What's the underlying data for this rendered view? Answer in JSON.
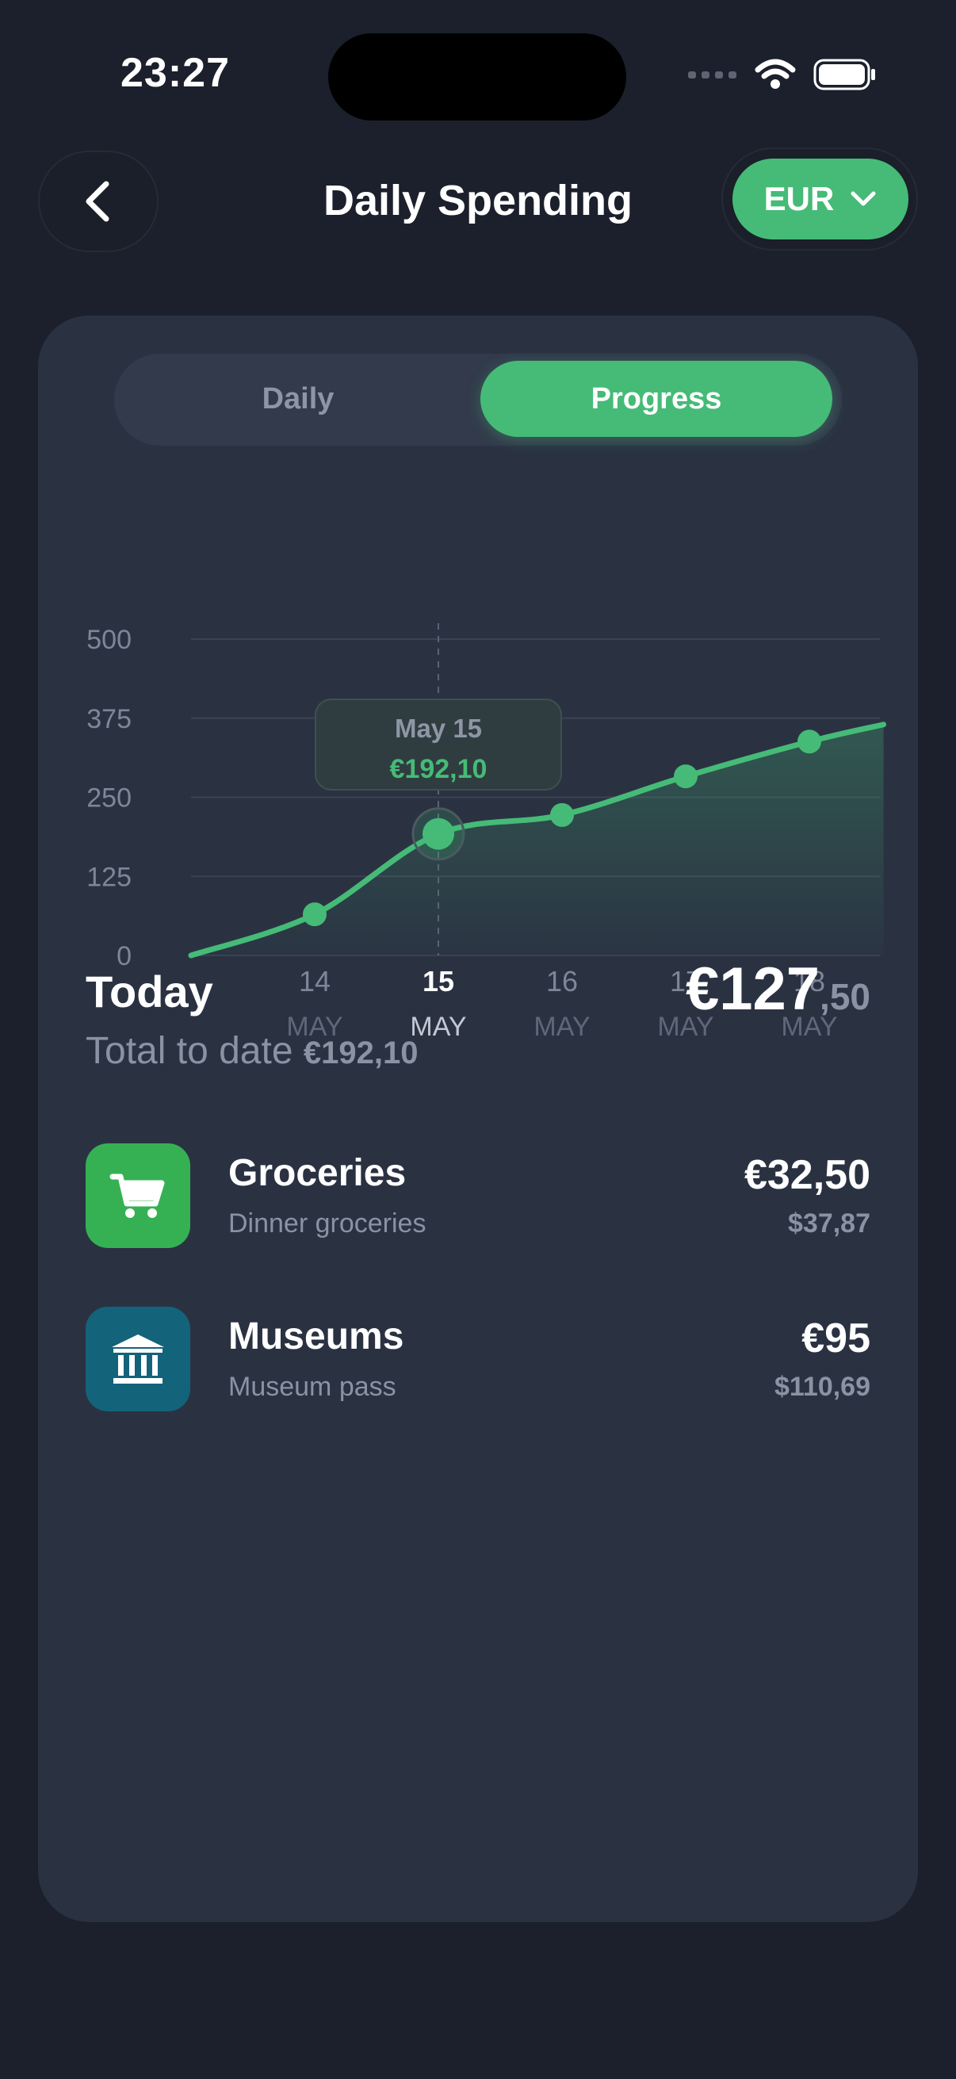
{
  "status_bar": {
    "time": "23:27"
  },
  "header": {
    "title": "Daily Spending",
    "currency": "EUR"
  },
  "segmented": {
    "daily": "Daily",
    "progress": "Progress",
    "selected": "Progress"
  },
  "tooltip": {
    "date": "May 15",
    "value": "€192,10"
  },
  "chart_data": {
    "type": "area",
    "y_ticks": [
      "500",
      "375",
      "250",
      "125",
      "0"
    ],
    "ylim": [
      0,
      500
    ],
    "x_labels": [
      {
        "day": "14",
        "month": "MAY"
      },
      {
        "day": "15",
        "month": "MAY"
      },
      {
        "day": "16",
        "month": "MAY"
      },
      {
        "day": "17",
        "month": "MAY"
      },
      {
        "day": "18",
        "month": "MAY"
      }
    ],
    "selected_index": 1,
    "series": [
      {
        "color": "#45bb77",
        "points": [
          {
            "x": 13,
            "y": 0
          },
          {
            "x": 14,
            "y": 65
          },
          {
            "x": 15,
            "y": 192.1
          },
          {
            "x": 16,
            "y": 222
          },
          {
            "x": 17,
            "y": 283
          },
          {
            "x": 18,
            "y": 338
          },
          {
            "x": 18.6,
            "y": 365
          }
        ]
      }
    ],
    "grid": true
  },
  "summary": {
    "today_label": "Today",
    "today_amount_main": "€127",
    "today_amount_cents": ",50",
    "total_label": "Total to date",
    "total_value": "€192,10"
  },
  "expenses": [
    {
      "title": "Groceries",
      "subtitle": "Dinner groceries",
      "amount": "€32,50",
      "converted": "$37,87",
      "icon": "shopping-cart-icon",
      "color": "#35b154"
    },
    {
      "title": "Museums",
      "subtitle": "Museum pass",
      "amount": "€95",
      "converted": "$110,69",
      "icon": "museum-icon",
      "color": "#13637a"
    }
  ],
  "colors": {
    "accent": "#45bb77",
    "background": "#1b202c",
    "card": "#2a3242"
  }
}
